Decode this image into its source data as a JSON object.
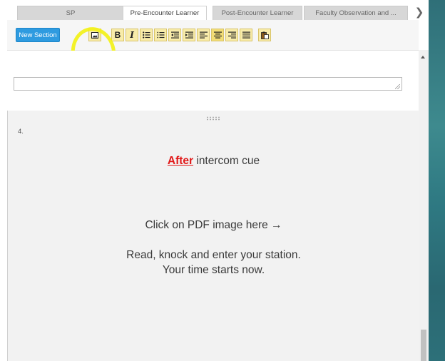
{
  "tabs": [
    {
      "label": "SP",
      "active": false
    },
    {
      "label": "Pre-Encounter Learner",
      "active": true
    },
    {
      "label": "Post-Encounter Learner",
      "active": false
    },
    {
      "label": "Faculty Observation and ...",
      "active": false
    }
  ],
  "tabs_more_icon": "chevron-right-icon",
  "toolbar": {
    "new_section_label": "New Section",
    "buttons": [
      {
        "icon": "insert-image-icon"
      },
      {
        "icon": "bold-icon",
        "text": "B"
      },
      {
        "icon": "italic-icon",
        "text": "I"
      },
      {
        "icon": "bulleted-list-icon"
      },
      {
        "icon": "numbered-list-icon"
      },
      {
        "icon": "outdent-icon"
      },
      {
        "icon": "indent-icon"
      },
      {
        "icon": "align-left-icon"
      },
      {
        "icon": "align-center-icon"
      },
      {
        "icon": "align-right-icon"
      },
      {
        "icon": "justify-icon"
      },
      {
        "icon": "paste-icon"
      }
    ],
    "highlight_color": "#f3f213",
    "accent_color": "#2e9be0"
  },
  "section": {
    "number": "4.",
    "after_word": "After",
    "line1_rest": " intercom cue",
    "line2": "Click on PDF image here →",
    "line3": "Read, knock and enter your station.",
    "line4": "Your time starts now.",
    "after_color": "#e11717"
  }
}
